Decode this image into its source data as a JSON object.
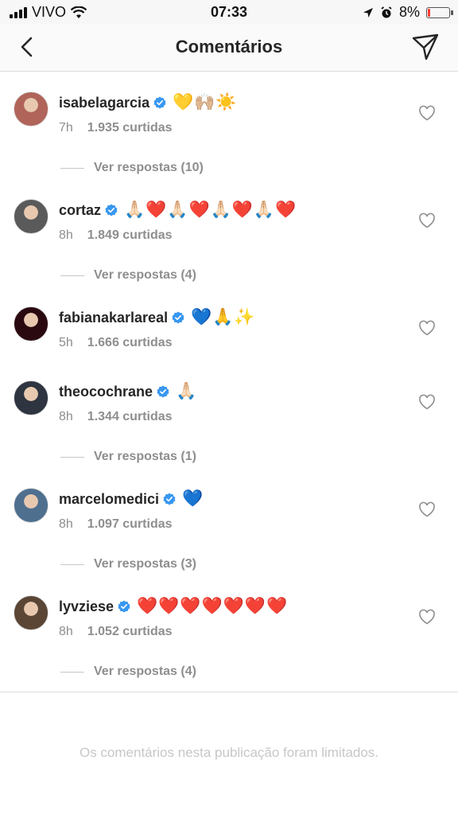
{
  "status": {
    "carrier": "VIVO",
    "time": "07:33",
    "battery": "8%"
  },
  "header": {
    "title": "Comentários"
  },
  "comments": [
    {
      "username": "isabelagarcia",
      "emojis": "💛🙌🏼☀️",
      "time": "7h",
      "likes": "1.935 curtidas",
      "replies": "Ver respostas (10)",
      "avatar_color": "#b0645a"
    },
    {
      "username": "cortaz",
      "emojis": "🙏🏻❤️🙏🏻❤️🙏🏻❤️🙏🏻❤️",
      "time": "8h",
      "likes": "1.849 curtidas",
      "replies": "Ver respostas (4)",
      "avatar_color": "#5a5a5a"
    },
    {
      "username": "fabianakarlareal",
      "emojis": "💙🙏✨",
      "time": "5h",
      "likes": "1.666 curtidas",
      "replies": "",
      "avatar_color": "#2a0a10"
    },
    {
      "username": "theocochrane",
      "emojis": "🙏🏻",
      "time": "8h",
      "likes": "1.344 curtidas",
      "replies": "Ver respostas (1)",
      "avatar_color": "#2e3440"
    },
    {
      "username": "marcelomedici",
      "emojis": "💙",
      "time": "8h",
      "likes": "1.097 curtidas",
      "replies": "Ver respostas (3)",
      "avatar_color": "#4f6f8f"
    },
    {
      "username": "lyvziese",
      "emojis": "❤️❤️❤️❤️❤️❤️❤️",
      "time": "8h",
      "likes": "1.052 curtidas",
      "replies": "Ver respostas (4)",
      "avatar_color": "#5b4636"
    }
  ],
  "footer": {
    "limited_text": "Os comentários nesta publicação foram limitados."
  },
  "colors": {
    "verified": "#3897f0",
    "battery_low": "#ff3b30",
    "muted": "#8e8e8e"
  }
}
